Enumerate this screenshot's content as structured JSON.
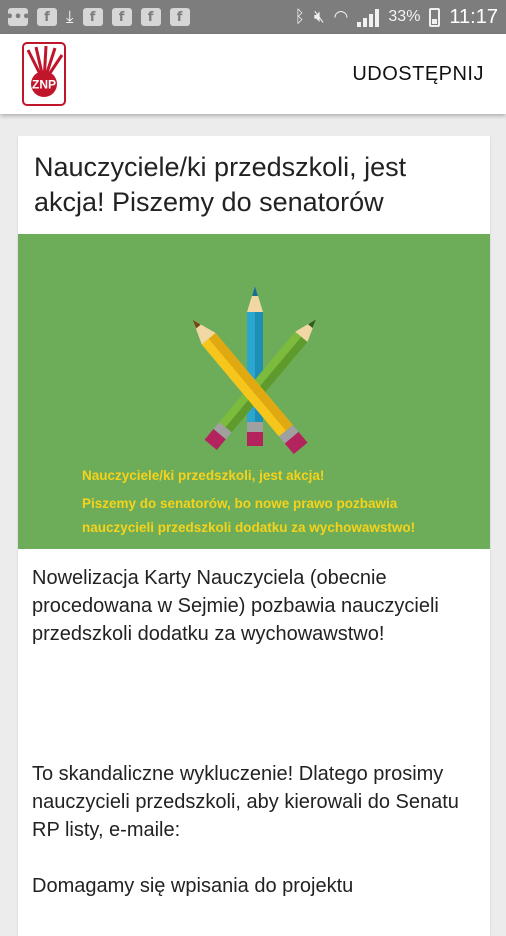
{
  "status_bar": {
    "battery": "33%",
    "time": "11:17"
  },
  "app_bar": {
    "logo_text": "ZNP",
    "share_label": "UDOSTĘPNIJ"
  },
  "article": {
    "title_line1": "Nauczyciele/ki przedszkoli, jest",
    "title_line2": "akcja! Piszemy do senatorów",
    "banner": {
      "line1": "Nauczyciele/ki przedszkoli, jest akcja!",
      "line2": "Piszemy do senatorów, bo nowe prawo pozbawia",
      "line3": "nauczycieli przedszkoli dodatku za wychowawstwo!",
      "background": "#6dad5a",
      "text_color": "#f7d21a"
    },
    "paragraph1": "Nowelizacja Karty Nauczyciela (obecnie procedowana w Sejmie) pozbawia nauczycieli przedszkoli  dodatku za wychowawstwo!",
    "paragraph2": "To skandaliczne wykluczenie! Dlatego prosimy nauczycieli przedszkoli, aby kierowali do Senatu RP listy, e-maile:",
    "paragraph3": "Domagamy się wpisania do projektu"
  }
}
